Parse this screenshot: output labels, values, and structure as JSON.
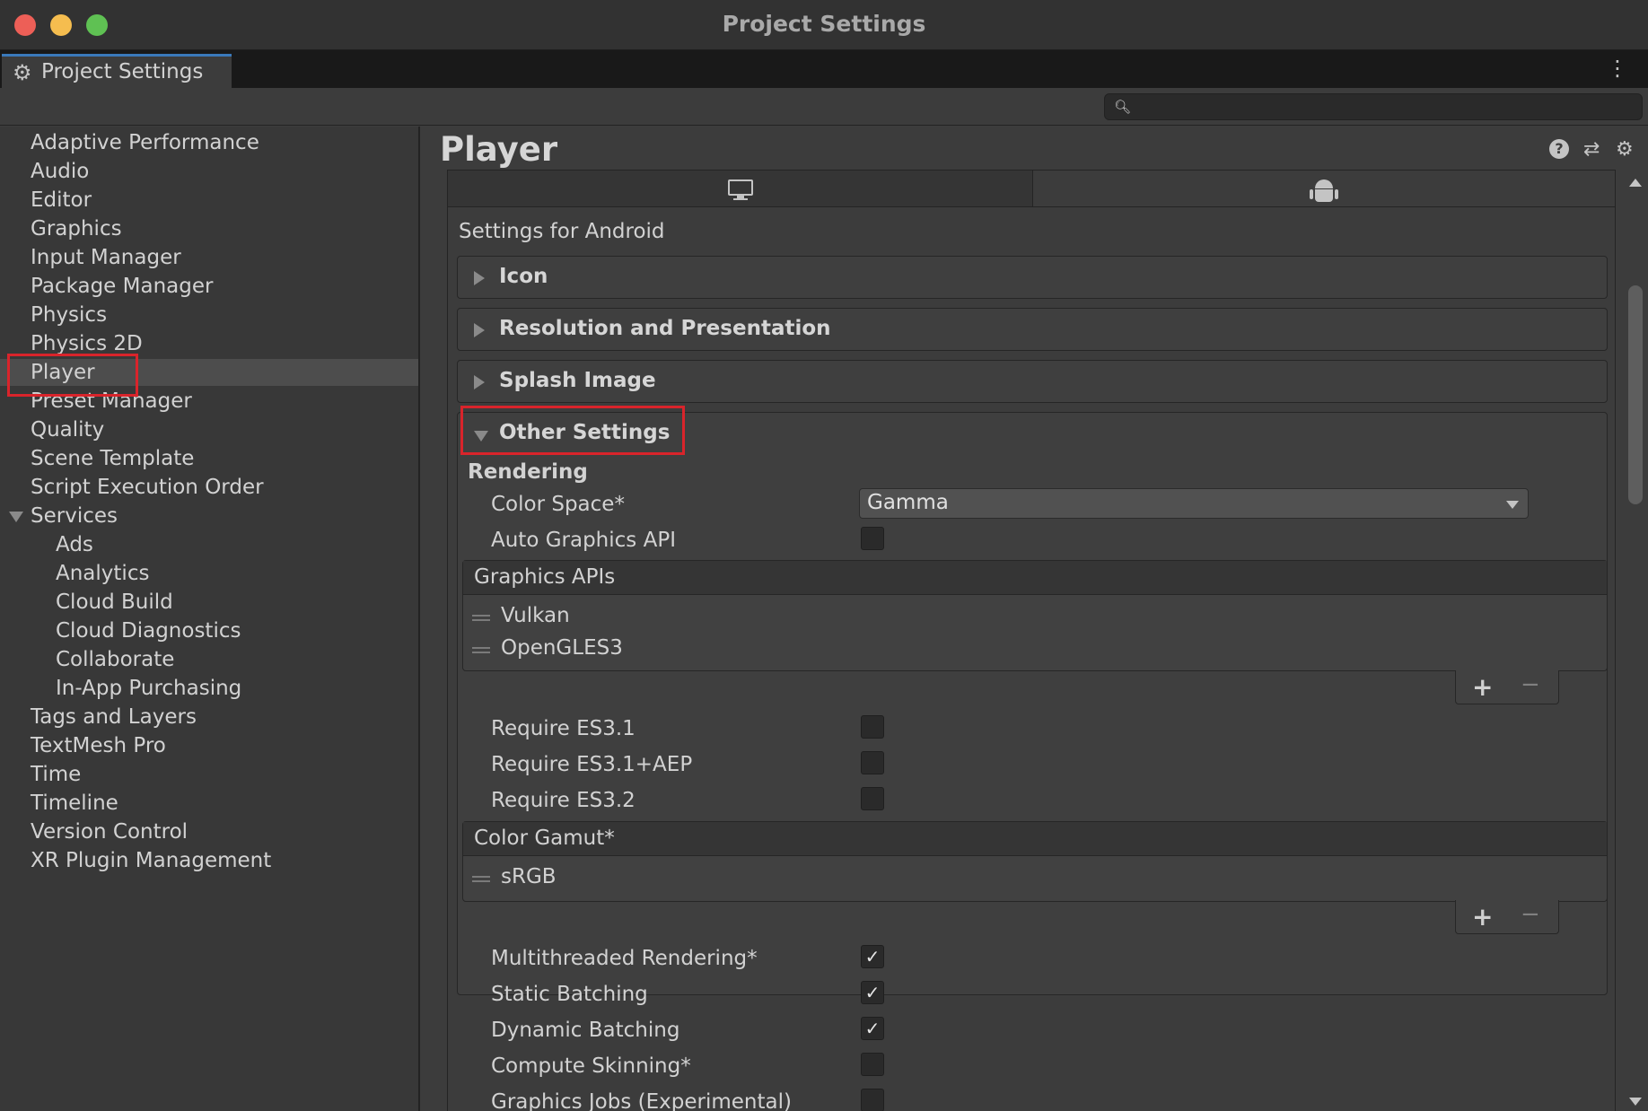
{
  "window": {
    "title": "Project Settings",
    "tab_label": "Project Settings",
    "search": {
      "value": "",
      "placeholder": ""
    }
  },
  "sidebar": {
    "items": [
      {
        "label": "Adaptive Performance"
      },
      {
        "label": "Audio"
      },
      {
        "label": "Editor"
      },
      {
        "label": "Graphics"
      },
      {
        "label": "Input Manager"
      },
      {
        "label": "Package Manager"
      },
      {
        "label": "Physics"
      },
      {
        "label": "Physics 2D"
      },
      {
        "label": "Player",
        "selected": true
      },
      {
        "label": "Preset Manager"
      },
      {
        "label": "Quality"
      },
      {
        "label": "Scene Template"
      },
      {
        "label": "Script Execution Order"
      },
      {
        "label": "Services",
        "expanded": true
      },
      {
        "label": "Ads"
      },
      {
        "label": "Analytics"
      },
      {
        "label": "Cloud Build"
      },
      {
        "label": "Cloud Diagnostics"
      },
      {
        "label": "Collaborate"
      },
      {
        "label": "In-App Purchasing"
      },
      {
        "label": "Tags and Layers"
      },
      {
        "label": "TextMesh Pro"
      },
      {
        "label": "Time"
      },
      {
        "label": "Timeline"
      },
      {
        "label": "Version Control"
      },
      {
        "label": "XR Plugin Management"
      }
    ]
  },
  "main": {
    "title": "Player",
    "help_icon_glyph": "?",
    "platform_tabs": [
      {
        "icon": "monitor-icon"
      },
      {
        "icon": "android-icon",
        "selected": true
      }
    ],
    "settings_for": "Settings for Android",
    "foldouts": [
      {
        "label": "Icon"
      },
      {
        "label": "Resolution and Presentation"
      },
      {
        "label": "Splash Image"
      },
      {
        "label": "Other Settings",
        "expanded": true
      }
    ],
    "rendering": {
      "heading": "Rendering",
      "color_space_label": "Color Space*",
      "color_space_value": "Gamma",
      "auto_graphics_api_label": "Auto Graphics API",
      "auto_graphics_api_checked": false,
      "graphics_apis": {
        "heading": "Graphics APIs",
        "items": [
          "Vulkan",
          "OpenGLES3"
        ]
      },
      "require_es31_label": "Require ES3.1",
      "require_es31_aep_label": "Require ES3.1+AEP",
      "require_es32_label": "Require ES3.2",
      "color_gamut": {
        "heading": "Color Gamut*",
        "items": [
          "sRGB"
        ]
      },
      "multithreaded_label": "Multithreaded Rendering*",
      "static_batching_label": "Static Batching",
      "dynamic_batching_label": "Dynamic Batching",
      "compute_skinning_label": "Compute Skinning*",
      "graphics_jobs_label": "Graphics Jobs (Experimental)",
      "check_mark": "✓",
      "plus_glyph": "+",
      "minus_glyph": "−"
    }
  },
  "colors": {
    "highlight_box": "#d9242b",
    "tab_accent": "#3a79bb"
  }
}
